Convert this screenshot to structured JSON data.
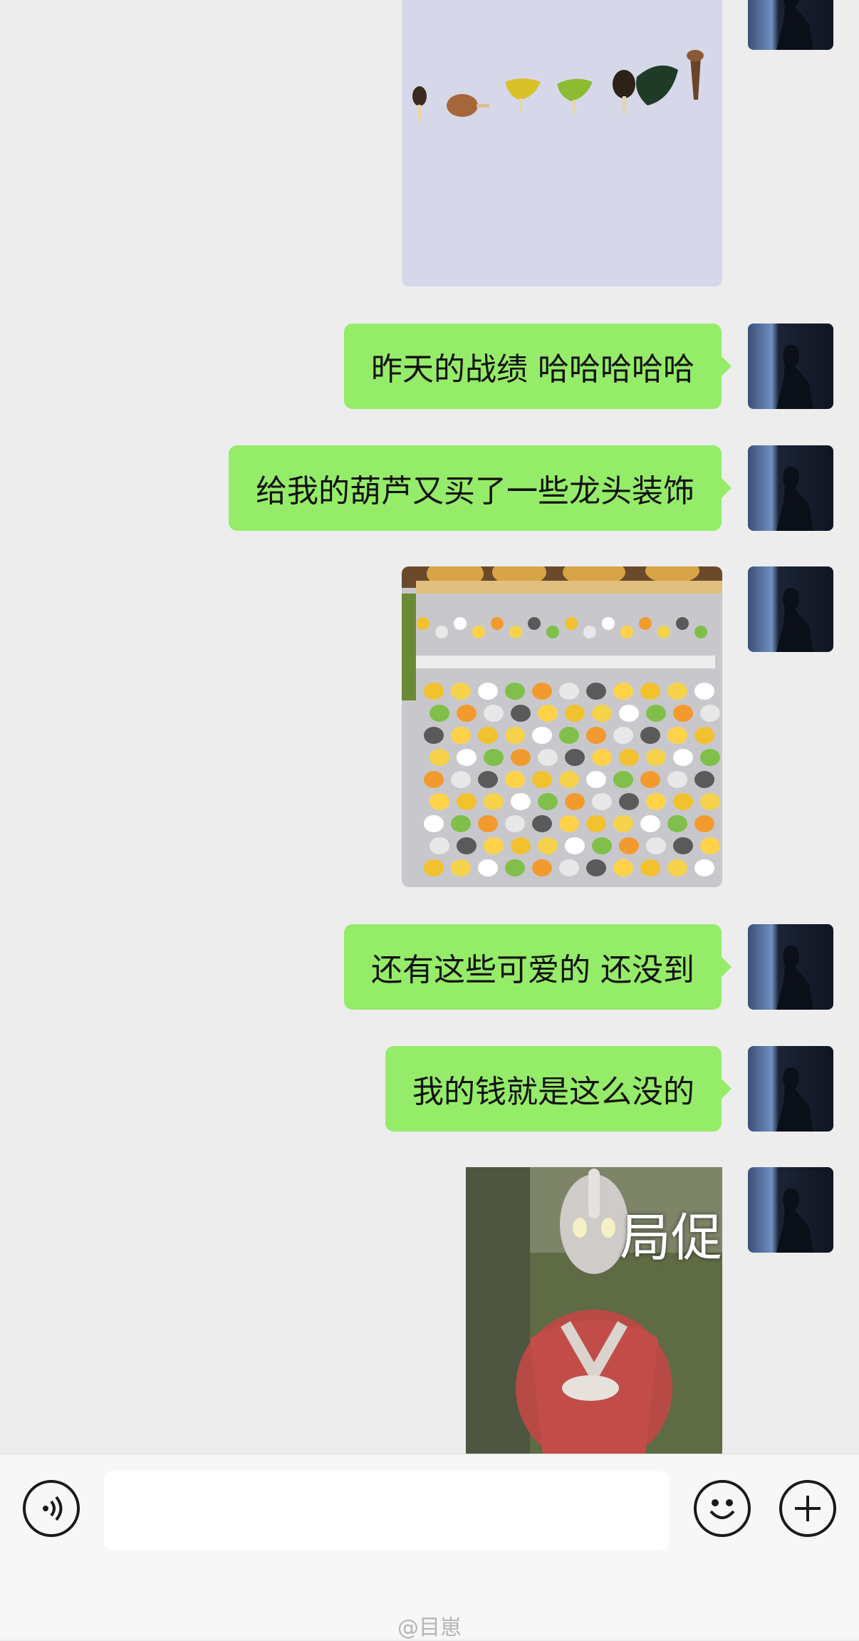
{
  "messages": [
    {
      "type": "image",
      "content": "ornaments-on-paper"
    },
    {
      "type": "text",
      "text": "昨天的战绩 哈哈哈哈哈"
    },
    {
      "type": "text",
      "text": "给我的葫芦又买了一些龙头装饰"
    },
    {
      "type": "image",
      "content": "cute-figurines-tray"
    },
    {
      "type": "text",
      "text": "还有这些可爱的 还没到"
    },
    {
      "type": "text",
      "text": "我的钱就是这么没的"
    },
    {
      "type": "image",
      "content": "ultraman-meme",
      "caption": "局促"
    }
  ],
  "input_bar": {
    "voice_icon": "voice-icon",
    "emoji_icon": "emoji-icon",
    "plus_icon": "plus-icon",
    "text_value": ""
  },
  "watermark": "@目崽",
  "colors": {
    "bubble": "#95ec69",
    "background": "#ededed"
  }
}
